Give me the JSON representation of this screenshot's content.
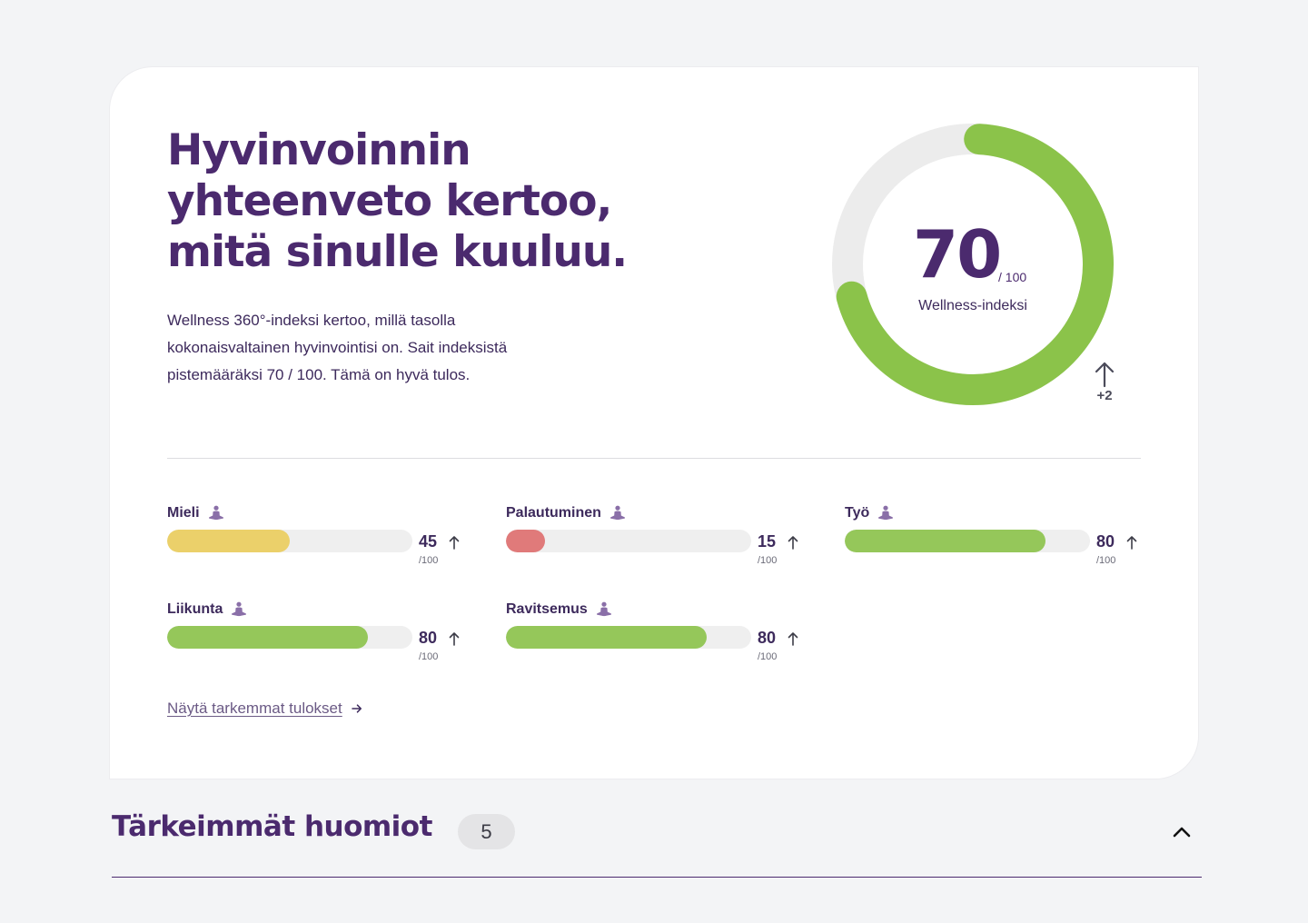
{
  "summary": {
    "headline": "Hyvinvoinnin yhteenveto kertoo, mitä sinulle kuuluu.",
    "intro": "Wellness 360°-indeksi kertoo, millä tasolla kokonaisvaltainen hyvinvointisi on. Sait indeksistä pistemääräksi 70 / 100. Tämä on hyvä tulos.",
    "gauge": {
      "value": "70",
      "max_label": "/ 100",
      "label": "Wellness-indeksi",
      "fraction": 0.7,
      "delta": "+2",
      "delta_icon": "arrow-up-icon",
      "fill_color": "#8bc34a",
      "track_color": "#ececec"
    },
    "metrics": [
      {
        "name": "Mieli",
        "score": "45",
        "max": "/100",
        "fraction": 0.5,
        "color": "#ebd06a",
        "icon": "meditation-icon",
        "trend_icon": "arrow-up-icon"
      },
      {
        "name": "Palautuminen",
        "score": "15",
        "max": "/100",
        "fraction": 0.16,
        "color": "#e07a7a",
        "icon": "meditation-icon",
        "trend_icon": "arrow-up-icon"
      },
      {
        "name": "Työ",
        "score": "80",
        "max": "/100",
        "fraction": 0.82,
        "color": "#95c75a",
        "icon": "meditation-icon",
        "trend_icon": "arrow-up-icon"
      },
      {
        "name": "Liikunta",
        "score": "80",
        "max": "/100",
        "fraction": 0.82,
        "color": "#95c75a",
        "icon": "meditation-icon",
        "trend_icon": "arrow-up-icon"
      },
      {
        "name": "Ravitsemus",
        "score": "80",
        "max": "/100",
        "fraction": 0.82,
        "color": "#95c75a",
        "icon": "meditation-icon",
        "trend_icon": "arrow-up-icon"
      }
    ],
    "more_link": "Näytä tarkemmat tulokset"
  },
  "highlights": {
    "title": "Tärkeimmät huomiot",
    "count": "5",
    "toggle_icon": "chevron-up-icon"
  },
  "colors": {
    "brand_purple": "#4b2a6e",
    "background": "#f3f4f6",
    "card": "#ffffff"
  }
}
